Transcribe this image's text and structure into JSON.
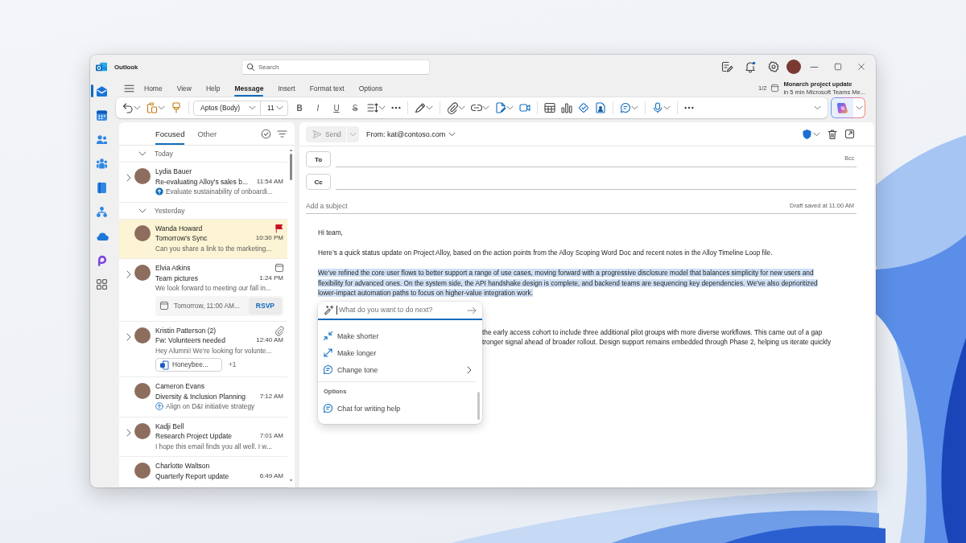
{
  "window": {
    "title": "Outlook"
  },
  "title_bar": {
    "search": {
      "placeholder": "Search"
    }
  },
  "nav_rail": {
    "items": [
      {
        "kind": "mail",
        "selected": true
      },
      {
        "kind": "calendar",
        "selected": false
      },
      {
        "kind": "people",
        "selected": false
      },
      {
        "kind": "groups",
        "selected": false
      },
      {
        "kind": "todo",
        "selected": false
      },
      {
        "kind": "org",
        "selected": false
      },
      {
        "kind": "cloud",
        "selected": false
      },
      {
        "kind": "loop",
        "selected": false
      },
      {
        "kind": "apps",
        "selected": false
      }
    ]
  },
  "ribbon": {
    "tabs": [
      {
        "label": "Home",
        "selected": false
      },
      {
        "label": "View",
        "selected": false
      },
      {
        "label": "Help",
        "selected": false
      },
      {
        "label": "Message",
        "selected": true
      },
      {
        "label": "Insert",
        "selected": false
      },
      {
        "label": "Format text",
        "selected": false
      },
      {
        "label": "Options",
        "selected": false
      }
    ],
    "reminder": {
      "count": "1/2",
      "title": "Monarch project update",
      "detail": "in 5 min Microsoft Teams Me..."
    },
    "toolbar": [
      {
        "kind": "undo",
        "dropdown": true
      },
      {
        "kind": "paste",
        "dropdown": true
      },
      {
        "kind": "format-painter"
      },
      {
        "kind": "separator"
      },
      {
        "kind": "font",
        "value": "Aptos (Body)"
      },
      {
        "kind": "size",
        "value": "11"
      },
      {
        "kind": "bold",
        "label": "B"
      },
      {
        "kind": "italic",
        "label": "I"
      },
      {
        "kind": "underline",
        "label": "U"
      },
      {
        "kind": "strikethrough",
        "label": "S"
      },
      {
        "kind": "line-spacing",
        "dropdown": true
      },
      {
        "kind": "more"
      },
      {
        "kind": "separator"
      },
      {
        "kind": "styles",
        "dropdown": true
      },
      {
        "kind": "separator"
      },
      {
        "kind": "attach",
        "dropdown": true
      },
      {
        "kind": "link",
        "dropdown": true
      },
      {
        "kind": "signature",
        "dropdown": true
      },
      {
        "kind": "video"
      },
      {
        "kind": "separator"
      },
      {
        "kind": "table"
      },
      {
        "kind": "chart"
      },
      {
        "kind": "loop"
      },
      {
        "kind": "sticker"
      },
      {
        "kind": "separator"
      },
      {
        "kind": "chat",
        "dropdown": true
      },
      {
        "kind": "separator"
      },
      {
        "kind": "dictate",
        "dropdown": true
      },
      {
        "kind": "separator"
      },
      {
        "kind": "more"
      }
    ]
  },
  "mail_list": {
    "tabs": [
      {
        "label": "Focused",
        "selected": true
      },
      {
        "label": "Other",
        "selected": false
      }
    ],
    "groups": [
      {
        "label": "Today",
        "expanded": true,
        "messages": [
          {
            "sender": "Lydia Bauer",
            "subject": "Re-evaluating Alloy's sales b...",
            "time": "11:54 AM",
            "preview": "Evaluate sustainability of onboardi...",
            "preview_icon": {
              "kind": "task-filled"
            },
            "thread": true,
            "selected": false
          }
        ]
      },
      {
        "label": "Yesterday",
        "expanded": true,
        "messages": [
          {
            "sender": "Wanda Howard",
            "subject": "Tomorrow's Sync",
            "time": "10:30 PM",
            "preview": "Can you share a link to the marketing...",
            "indicator": {
              "kind": "flag"
            },
            "thread": false,
            "selected": true
          },
          {
            "sender": "Elvia Atkins",
            "subject": "Team pictures",
            "time": "1:24 PM",
            "preview": "We look forward to meeting our fall in...",
            "indicator": {
              "kind": "calendar"
            },
            "thread": true,
            "selected": false,
            "event": {
              "when": "Tomorrow, 11:00 AM...",
              "action": "RSVP"
            }
          },
          {
            "sender": "Kristin Patterson (2)",
            "subject": "Fw: Volunteers needed",
            "time": "12:40 AM",
            "preview": "Hey Alumni! We're looking for volunte...",
            "indicator": {
              "kind": "attachment"
            },
            "thread": true,
            "selected": false,
            "attachment": {
              "name": "Honeybee...",
              "more": "+1"
            }
          },
          {
            "sender": "Cameron Evans",
            "subject": "Diversity & Inclusion Planning",
            "time": "7:12 AM",
            "preview": "Align on D&I initiative strategy",
            "preview_icon": {
              "kind": "task-outline"
            },
            "thread": false,
            "selected": false
          },
          {
            "sender": "Kadji Bell",
            "subject": "Research Project Update",
            "time": "7:01 AM",
            "preview": "I hope this email finds you all well. I w...",
            "thread": true,
            "selected": false
          },
          {
            "sender": "Charlotte Waltson",
            "subject": "Quarterly Report update",
            "time": "6:49 AM",
            "thread": false,
            "selected": false
          }
        ]
      }
    ]
  },
  "compose": {
    "send": {
      "label": "Send",
      "disabled": true
    },
    "from": "From: kat@contoso.com",
    "to": {
      "label": "To"
    },
    "bcc": "Bcc",
    "cc": {
      "label": "Cc"
    },
    "subject": {
      "placeholder": "Add a subject"
    },
    "draft_status": "Draft saved at 11:00 AM",
    "body": [
      {
        "kind": "paragraph",
        "text": "Hi team,",
        "highlighted": false
      },
      {
        "kind": "paragraph",
        "text": "Here’s a quick status update on Project Alloy, based on the action points from the Alloy Scoping Word Doc and recent notes in the Alloy Timeline Loop file.",
        "highlighted": false
      },
      {
        "kind": "paragraph",
        "text": "We’ve refined the core user flows to better support a range of use cases, moving forward with a progressive disclosure model that balances simplicity for new users and flexibility for advanced ones. On the system side, the API handshake design is complete, and backend teams are sequencing key dependencies. We’ve also deprioritized lower-impact automation paths to focus on higher-value integration work.",
        "highlighted": true
      },
      {
        "kind": "covered",
        "lines": [
          "the early access cohort to include three additional pilot groups with more diverse workflows. This came out of a gap",
          "tronger signal ahead of broader rollout. Design support remains embedded through Phase 2, helping us iterate quickly"
        ]
      }
    ]
  },
  "copilot_menu": {
    "prompt": {
      "placeholder": "What do you want to do next?"
    },
    "actions": [
      {
        "kind": "shorter",
        "label": "Make shorter",
        "submenu": false
      },
      {
        "kind": "longer",
        "label": "Make longer",
        "submenu": false
      },
      {
        "kind": "tone",
        "label": "Change tone",
        "submenu": true
      }
    ],
    "section": "Options",
    "options": [
      {
        "kind": "chat",
        "label": "Chat for writing help",
        "submenu": false
      }
    ]
  }
}
